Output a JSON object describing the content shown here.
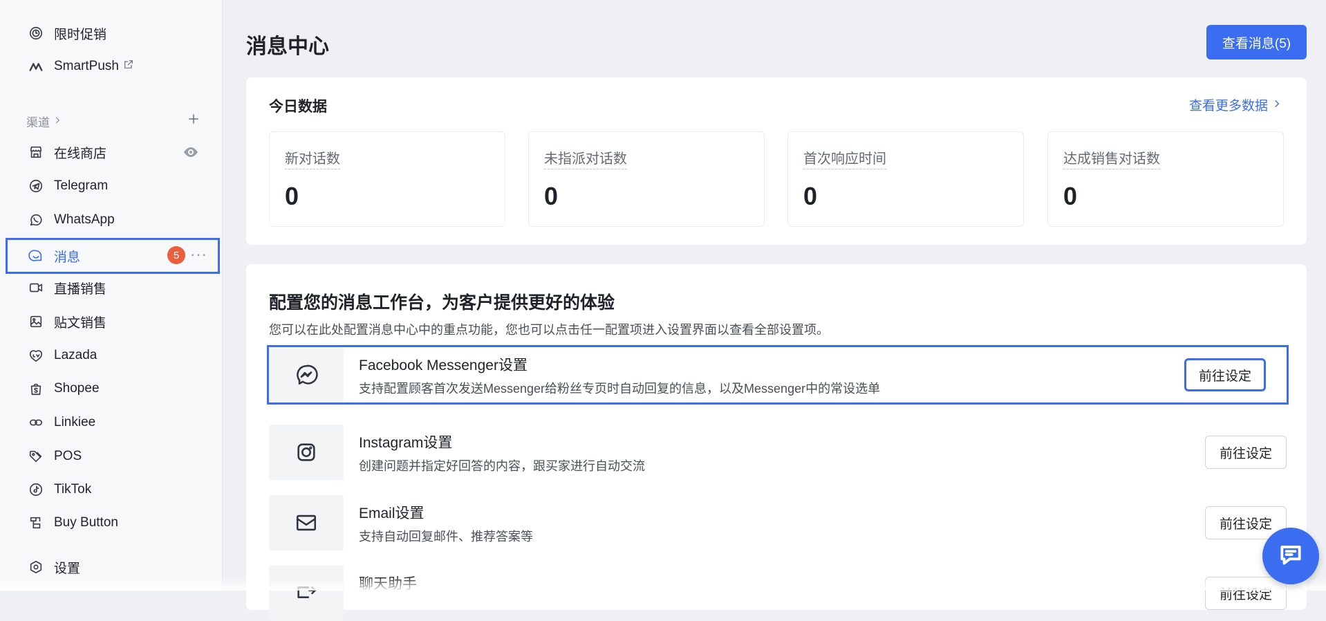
{
  "sidebar": {
    "items": [
      {
        "label": "限时促销",
        "icon": "coin-clock-icon"
      },
      {
        "label": "SmartPush",
        "icon": "smartpush-logo-icon"
      },
      {
        "label": "在线商店",
        "icon": "store-icon"
      },
      {
        "label": "Telegram",
        "icon": "telegram-icon"
      },
      {
        "label": "WhatsApp",
        "icon": "whatsapp-icon"
      },
      {
        "label": "消息",
        "icon": "chat-bubble-icon"
      },
      {
        "label": "直播销售",
        "icon": "video-icon"
      },
      {
        "label": "贴文销售",
        "icon": "image-post-icon"
      },
      {
        "label": "Lazada",
        "icon": "lazada-icon"
      },
      {
        "label": "Shopee",
        "icon": "shopee-bag-icon"
      },
      {
        "label": "Linkiee",
        "icon": "link-icon"
      },
      {
        "label": "POS",
        "icon": "tag-icon"
      },
      {
        "label": "TikTok",
        "icon": "tiktok-icon"
      },
      {
        "label": "Buy Button",
        "icon": "buy-button-icon"
      },
      {
        "label": "设置",
        "icon": "gear-icon"
      }
    ],
    "section_label": "渠道",
    "message_badge": "5",
    "more": "···"
  },
  "header": {
    "title": "消息中心",
    "view_messages_button": "查看消息(5)"
  },
  "today": {
    "title": "今日数据",
    "more_link": "查看更多数据",
    "stats": [
      {
        "label": "新对话数",
        "value": "0"
      },
      {
        "label": "未指派对话数",
        "value": "0"
      },
      {
        "label": "首次响应时间",
        "value": "0"
      },
      {
        "label": "达成销售对话数",
        "value": "0"
      }
    ]
  },
  "config": {
    "title": "配置您的消息工作台，为客户提供更好的体验",
    "description": "您可以在此处配置消息中心中的重点功能，您也可以点击任一配置项进入设置界面以查看全部设置项。",
    "rows": [
      {
        "name": "Facebook Messenger设置",
        "desc": "支持配置顾客首次发送Messenger给粉丝专页时自动回复的信息，以及Messenger中的常设选单",
        "button": "前往设定",
        "icon": "messenger-icon"
      },
      {
        "name": "Instagram设置",
        "desc": "创建问题并指定好回答的内容，跟买家进行自动交流",
        "button": "前往设定",
        "icon": "instagram-icon"
      },
      {
        "name": "Email设置",
        "desc": "支持自动回复邮件、推荐答案等",
        "button": "前往设定",
        "icon": "email-icon"
      },
      {
        "name": "聊天助手",
        "desc": "",
        "button": "前往设定",
        "icon": "chat-assistant-icon"
      }
    ]
  },
  "colors": {
    "accent": "#3b6df0",
    "badge": "#e8603c"
  }
}
